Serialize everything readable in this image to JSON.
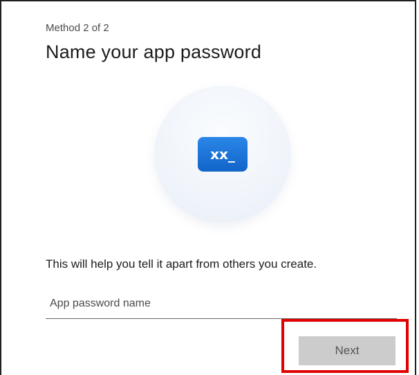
{
  "header": {
    "step_text": "Method 2 of 2",
    "title": "Name your app password"
  },
  "illustration": {
    "icon": "password-icon",
    "badge_text": "xx_",
    "badge_color": "#1a73d8"
  },
  "form": {
    "description": "This will help you tell it apart from others you create.",
    "name_input": {
      "value": "",
      "placeholder": "App password name"
    },
    "next_label": "Next"
  },
  "colors": {
    "button_disabled_bg": "#cccccc",
    "highlight_border": "#e00000"
  }
}
